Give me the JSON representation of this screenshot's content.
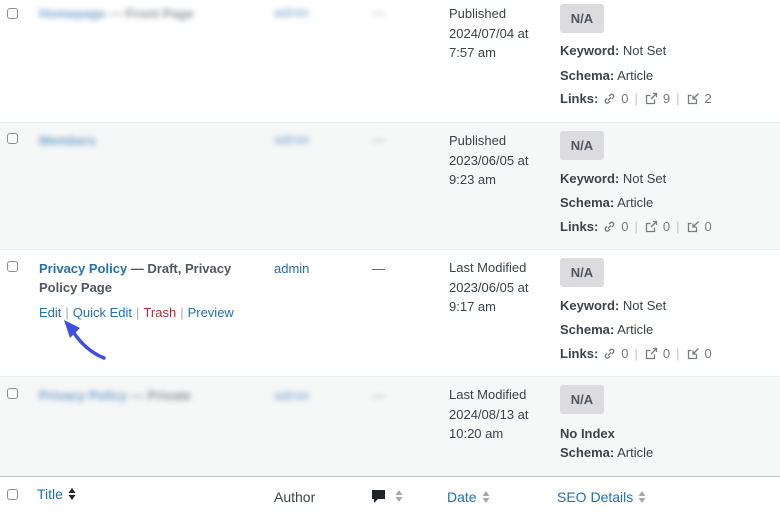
{
  "rows": [
    {
      "title": "Homepage",
      "state": "— Front Page",
      "author": "admin",
      "comments": "—",
      "date": [
        "Published",
        "2024/07/04 at",
        "7:57 am"
      ],
      "seo_score": "N/A",
      "keyword_label": "Keyword:",
      "keyword_value": "Not Set",
      "schema_label": "Schema:",
      "schema_value": "Article",
      "links_label": "Links:",
      "links_internal": "0",
      "links_external": "9",
      "links_incoming": "2"
    },
    {
      "title": "Members",
      "state": "",
      "author": "admin",
      "comments": "—",
      "date": [
        "Published",
        "2023/06/05 at",
        "9:23 am"
      ],
      "seo_score": "N/A",
      "keyword_label": "Keyword:",
      "keyword_value": "Not Set",
      "schema_label": "Schema:",
      "schema_value": "Article",
      "links_label": "Links:",
      "links_internal": "0",
      "links_external": "0",
      "links_incoming": "0"
    },
    {
      "title": "Privacy Policy",
      "state": "— Draft, Privacy Policy Page",
      "author": "admin",
      "comments": "—",
      "date": [
        "Last Modified",
        "2023/06/05 at",
        "9:17 am"
      ],
      "seo_score": "N/A",
      "keyword_label": "Keyword:",
      "keyword_value": "Not Set",
      "schema_label": "Schema:",
      "schema_value": "Article",
      "links_label": "Links:",
      "links_internal": "0",
      "links_external": "0",
      "links_incoming": "0",
      "actions": {
        "edit": "Edit",
        "quick_edit": "Quick Edit",
        "trash": "Trash",
        "preview": "Preview",
        "sep": "|"
      }
    },
    {
      "title": "Privacy Policy",
      "state": "— Private",
      "author": "admin",
      "comments": "—",
      "date": [
        "Last Modified",
        "2024/08/13 at",
        "10:20 am"
      ],
      "seo_score": "N/A",
      "robots": "No Index",
      "schema_label": "Schema:",
      "schema_value": "Article"
    }
  ],
  "footer": {
    "title": "Title",
    "author": "Author",
    "comments_icon": "comment-bubble-icon",
    "date": "Date",
    "seo_details": "SEO Details"
  },
  "colors": {
    "link": "#2271b1",
    "trash": "#b32d2e",
    "badge_bg": "#dcdcde",
    "row_alt": "#f6f7f7",
    "annotation_arrow": "#3b4fe0"
  }
}
